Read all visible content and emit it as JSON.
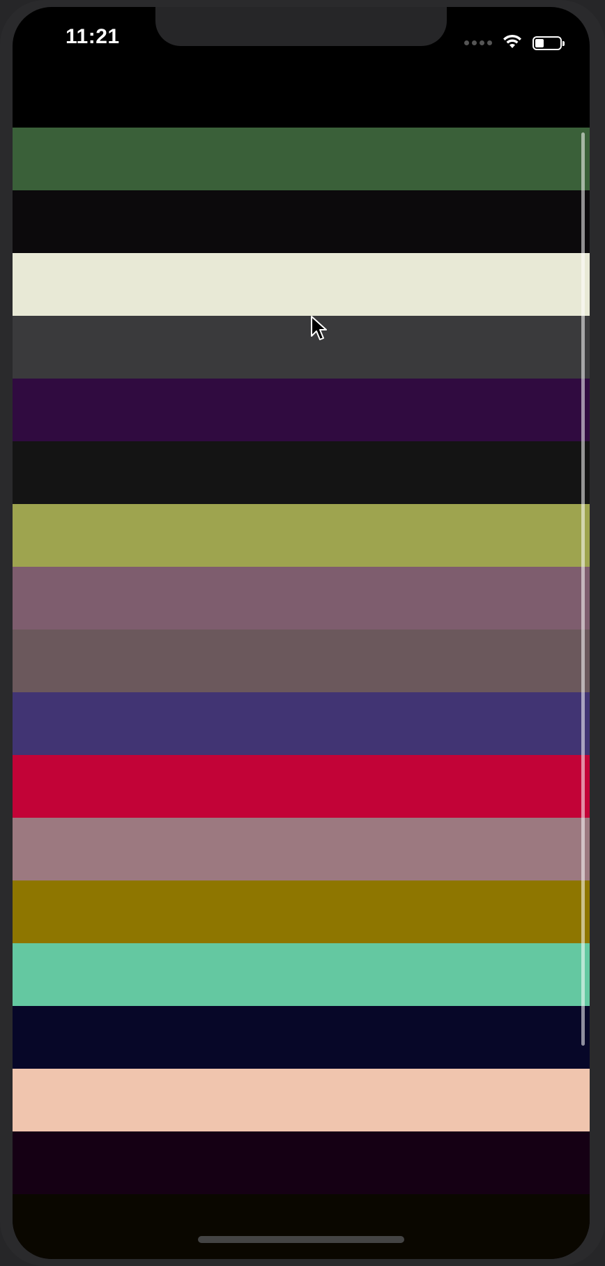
{
  "status_bar": {
    "time": "11:21",
    "wifi_icon": "wifi-icon",
    "battery_icon": "battery-icon"
  },
  "list": {
    "stripes": [
      {
        "color": "#3a6039"
      },
      {
        "color": "#0c0a0c"
      },
      {
        "color": "#e8e9d6"
      },
      {
        "color": "#3a3a3c"
      },
      {
        "color": "#300b40"
      },
      {
        "color": "#141414"
      },
      {
        "color": "#9ea44f"
      },
      {
        "color": "#7e5d6e"
      },
      {
        "color": "#6b585c"
      },
      {
        "color": "#413473"
      },
      {
        "color": "#c20337"
      },
      {
        "color": "#9c7980"
      },
      {
        "color": "#8e7600"
      },
      {
        "color": "#64c8a1"
      },
      {
        "color": "#070728"
      },
      {
        "color": "#f0c5ae"
      },
      {
        "color": "#150014"
      }
    ]
  },
  "colors": {
    "screen_background": "#000000",
    "frame": "#2a2a2c"
  }
}
